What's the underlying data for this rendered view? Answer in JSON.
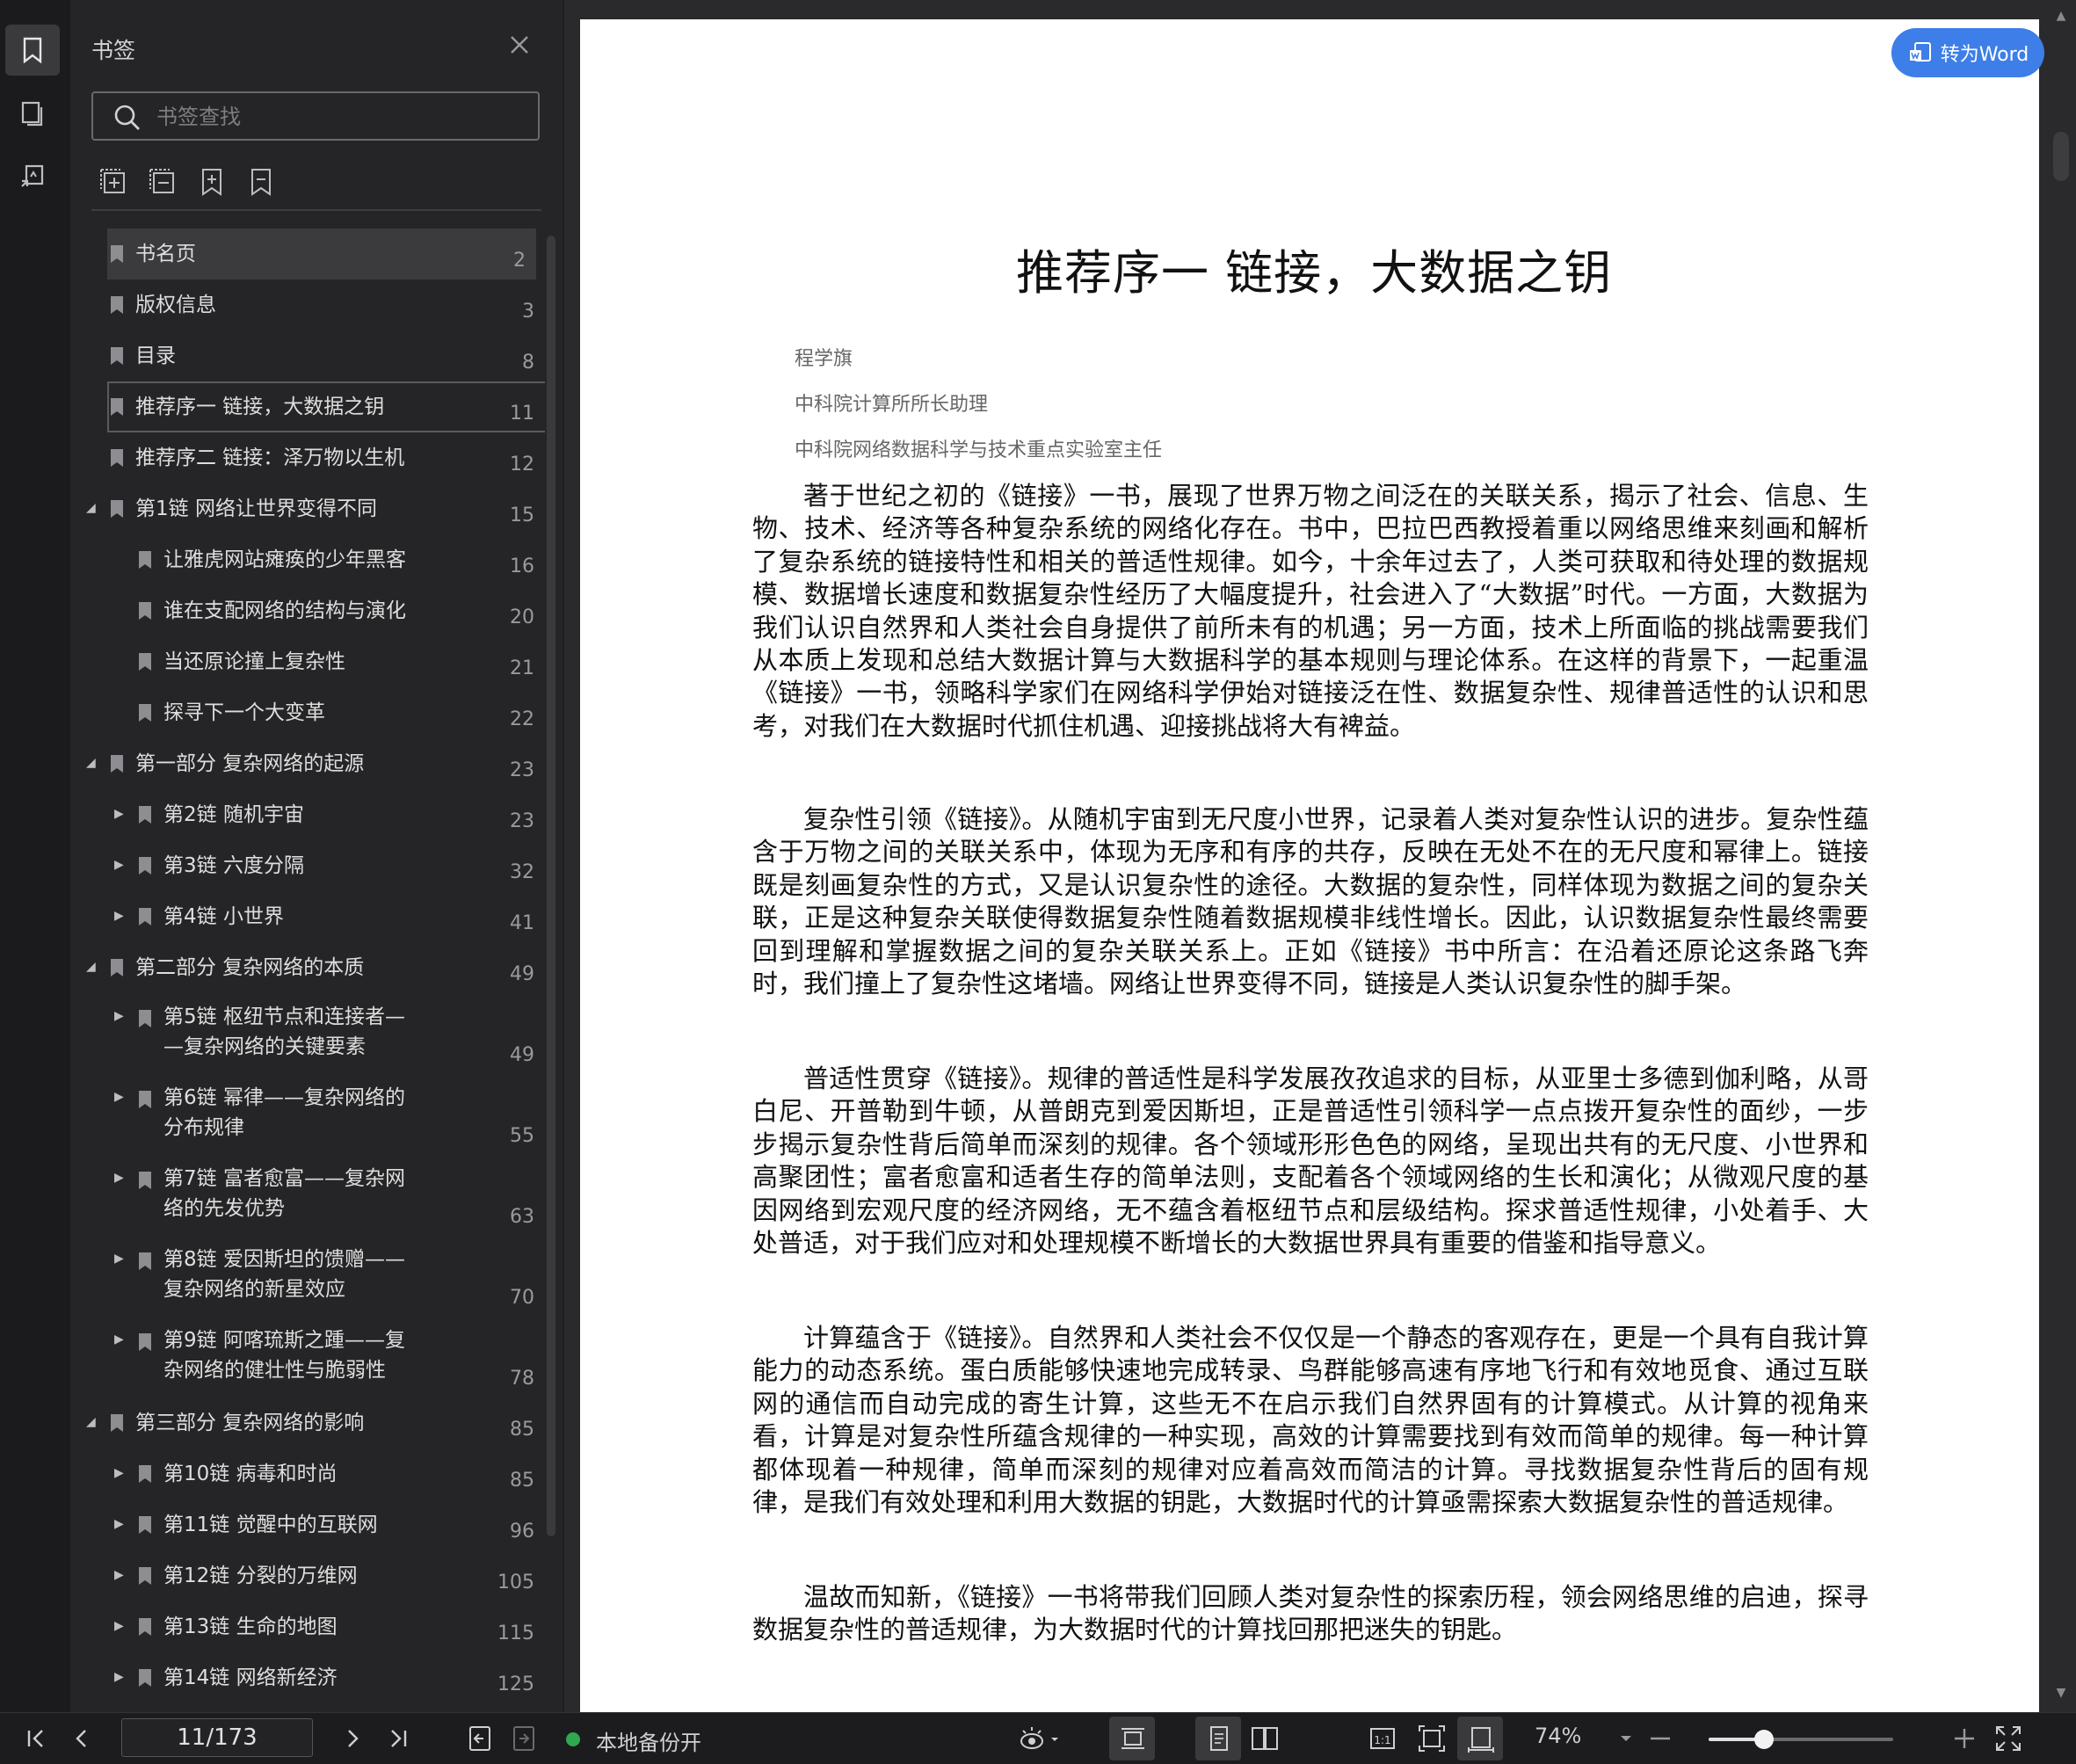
{
  "panel": {
    "title": "书签",
    "search_placeholder": "书签查找"
  },
  "bookmarks": [
    {
      "label": "书名页",
      "page": "2",
      "level": 0,
      "expander": "none",
      "selected": true
    },
    {
      "label": "版权信息",
      "page": "3",
      "level": 0,
      "expander": "none"
    },
    {
      "label": "目录",
      "page": "8",
      "level": 0,
      "expander": "none"
    },
    {
      "label": "推荐序一 链接，大数据之钥",
      "page": "11",
      "level": 0,
      "expander": "none",
      "focused": true
    },
    {
      "label": "推荐序二 链接：泽万物以生机",
      "page": "12",
      "level": 0,
      "expander": "none"
    },
    {
      "label": "第1链 网络让世界变得不同",
      "page": "15",
      "level": 0,
      "expander": "expanded"
    },
    {
      "label": "让雅虎网站瘫痪的少年黑客",
      "page": "16",
      "level": 1,
      "expander": "none"
    },
    {
      "label": "谁在支配网络的结构与演化",
      "page": "20",
      "level": 1,
      "expander": "none"
    },
    {
      "label": "当还原论撞上复杂性",
      "page": "21",
      "level": 1,
      "expander": "none"
    },
    {
      "label": "探寻下一个大变革",
      "page": "22",
      "level": 1,
      "expander": "none"
    },
    {
      "label": "第一部分 复杂网络的起源",
      "page": "23",
      "level": 0,
      "expander": "expanded"
    },
    {
      "label": "第2链 随机宇宙",
      "page": "23",
      "level": 1,
      "expander": "collapsed"
    },
    {
      "label": "第3链 六度分隔",
      "page": "32",
      "level": 1,
      "expander": "collapsed"
    },
    {
      "label": "第4链 小世界",
      "page": "41",
      "level": 1,
      "expander": "collapsed"
    },
    {
      "label": "第二部分 复杂网络的本质",
      "page": "49",
      "level": 0,
      "expander": "expanded"
    },
    {
      "label": "第5链 枢纽节点和连接者—\n—复杂网络的关键要素",
      "page": "49",
      "level": 1,
      "expander": "collapsed",
      "lines": 2
    },
    {
      "label": "第6链 幂律——复杂网络的\n分布规律",
      "page": "55",
      "level": 1,
      "expander": "collapsed",
      "lines": 2
    },
    {
      "label": "第7链 富者愈富——复杂网\n络的先发优势",
      "page": "63",
      "level": 1,
      "expander": "collapsed",
      "lines": 2
    },
    {
      "label": "第8链 爱因斯坦的馈赠——\n复杂网络的新星效应",
      "page": "70",
      "level": 1,
      "expander": "collapsed",
      "lines": 2
    },
    {
      "label": "第9链 阿喀琉斯之踵——复\n杂网络的健壮性与脆弱性",
      "page": "78",
      "level": 1,
      "expander": "collapsed",
      "lines": 2
    },
    {
      "label": "第三部分 复杂网络的影响",
      "page": "85",
      "level": 0,
      "expander": "expanded"
    },
    {
      "label": "第10链 病毒和时尚",
      "page": "85",
      "level": 1,
      "expander": "collapsed"
    },
    {
      "label": "第11链 觉醒中的互联网",
      "page": "96",
      "level": 1,
      "expander": "collapsed"
    },
    {
      "label": "第12链 分裂的万维网",
      "page": "105",
      "level": 1,
      "expander": "collapsed"
    },
    {
      "label": "第13链 生命的地图",
      "page": "115",
      "level": 1,
      "expander": "collapsed"
    },
    {
      "label": "第14链 网络新经济",
      "page": "125",
      "level": 1,
      "expander": "collapsed"
    }
  ],
  "document": {
    "convert_button": "转为Word",
    "title": "推荐序一 链接，大数据之钥",
    "author": "程学旗",
    "position1": "中科院计算所所长助理",
    "position2": "中科院网络数据科学与技术重点实验室主任",
    "paragraphs": [
      "著于世纪之初的《链接》一书，展现了世界万物之间泛在的关联关系，揭示了社会、信息、生物、技术、经济等各种复杂系统的网络化存在。书中，巴拉巴西教授着重以网络思维来刻画和解析了复杂系统的链接特性和相关的普适性规律。如今，十余年过去了，人类可获取和待处理的数据规模、数据增长速度和数据复杂性经历了大幅度提升，社会进入了“大数据”时代。一方面，大数据为我们认识自然界和人类社会自身提供了前所未有的机遇；另一方面，技术上所面临的挑战需要我们从本质上发现和总结大数据计算与大数据科学的基本规则与理论体系。在这样的背景下，一起重温《链接》一书，领略科学家们在网络科学伊始对链接泛在性、数据复杂性、规律普适性的认识和思考，对我们在大数据时代抓住机遇、迎接挑战将大有裨益。",
      "复杂性引领《链接》。从随机宇宙到无尺度小世界，记录着人类对复杂性认识的进步。复杂性蕴含于万物之间的关联关系中，体现为无序和有序的共存，反映在无处不在的无尺度和幂律上。链接既是刻画复杂性的方式，又是认识复杂性的途径。大数据的复杂性，同样体现为数据之间的复杂关联，正是这种复杂关联使得数据复杂性随着数据规模非线性增长。因此，认识数据复杂性最终需要回到理解和掌握数据之间的复杂关联关系上。正如《链接》书中所言：在沿着还原论这条路飞奔时，我们撞上了复杂性这堵墙。网络让世界变得不同，链接是人类认识复杂性的脚手架。",
      "普适性贯穿《链接》。规律的普适性是科学发展孜孜追求的目标，从亚里士多德到伽利略，从哥白尼、开普勒到牛顿，从普朗克到爱因斯坦，正是普适性引领科学一点点拨开复杂性的面纱，一步步揭示复杂性背后简单而深刻的规律。各个领域形形色色的网络，呈现出共有的无尺度、小世界和高聚团性；富者愈富和适者生存的简单法则，支配着各个领域网络的生长和演化；从微观尺度的基因网络到宏观尺度的经济网络，无不蕴含着枢纽节点和层级结构。探求普适性规律，小处着手、大处普适，对于我们应对和处理规模不断增长的大数据世界具有重要的借鉴和指导意义。",
      "计算蕴含于《链接》。自然界和人类社会不仅仅是一个静态的客观存在，更是一个具有自我计算能力的动态系统。蛋白质能够快速地完成转录、鸟群能够高速有序地飞行和有效地觅食、通过互联网的通信而自动完成的寄生计算，这些无不在启示我们自然界固有的计算模式。从计算的视角来看，计算是对复杂性所蕴含规律的一种实现，高效的计算需要找到有效而简单的规律。每一种计算都体现着一种规律，简单而深刻的规律对应着高效而简洁的计算。寻找数据复杂性背后的固有规律，是我们有效处理和利用大数据的钥匙，大数据时代的计算亟需探索大数据复杂性的普适规律。",
      "温故而知新，《链接》一书将带我们回顾人类对复杂性的探索历程，领会网络思维的启迪，探寻数据复杂性的普适规律，为大数据时代的计算找回那把迷失的钥匙。"
    ]
  },
  "statusbar": {
    "page_indicator": "11/173",
    "backup_status": "本地备份开",
    "zoom": "74%",
    "zoom_level": 0.3
  }
}
